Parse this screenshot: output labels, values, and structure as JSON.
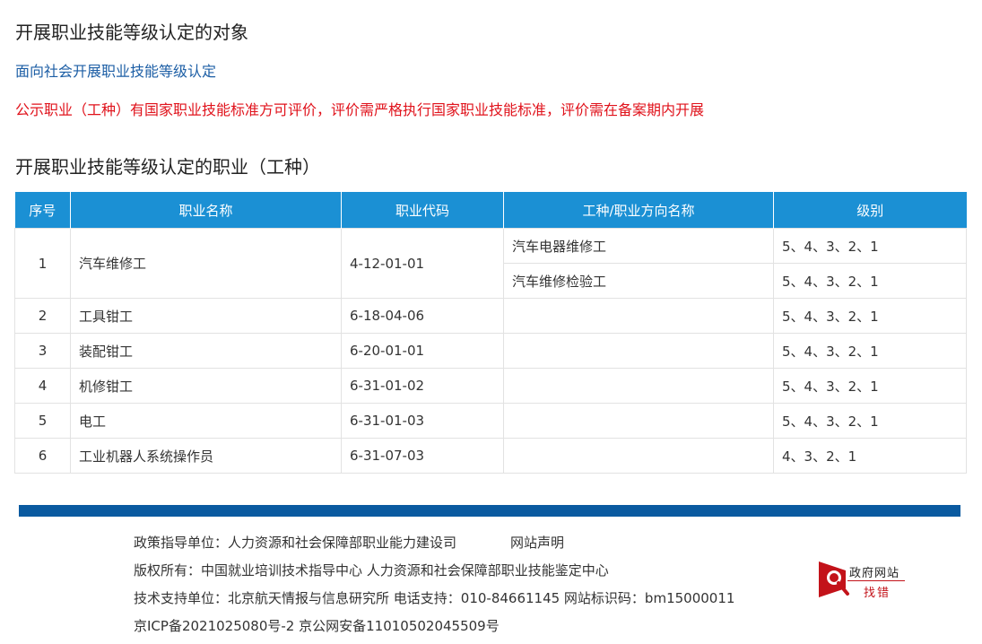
{
  "section1": {
    "title": "开展职业技能等级认定的对象",
    "subtitle": "面向社会开展职业技能等级认定",
    "notice": "公示职业（工种）有国家职业技能标准方可评价，评价需严格执行国家职业技能标准，评价需在备案期内开展"
  },
  "section2": {
    "title": "开展职业技能等级认定的职业（工种）",
    "headers": [
      "序号",
      "职业名称",
      "职业代码",
      "工种/职业方向名称",
      "级别"
    ],
    "rows": [
      {
        "no": "1",
        "name": "汽车维修工",
        "code": "4-12-01-01",
        "directions": [
          {
            "direction": "汽车电器维修工",
            "level": "5、4、3、2、1"
          },
          {
            "direction": "汽车维修检验工",
            "level": "5、4、3、2、1"
          }
        ]
      },
      {
        "no": "2",
        "name": "工具钳工",
        "code": "6-18-04-06",
        "directions": [
          {
            "direction": "",
            "level": "5、4、3、2、1"
          }
        ]
      },
      {
        "no": "3",
        "name": "装配钳工",
        "code": "6-20-01-01",
        "directions": [
          {
            "direction": "",
            "level": "5、4、3、2、1"
          }
        ]
      },
      {
        "no": "4",
        "name": "机修钳工",
        "code": "6-31-01-02",
        "directions": [
          {
            "direction": "",
            "level": "5、4、3、2、1"
          }
        ]
      },
      {
        "no": "5",
        "name": "电工",
        "code": "6-31-01-03",
        "directions": [
          {
            "direction": "",
            "level": "5、4、3、2、1"
          }
        ]
      },
      {
        "no": "6",
        "name": "工业机器人系统操作员",
        "code": "6-31-07-03",
        "directions": [
          {
            "direction": "",
            "level": "4、3、2、1"
          }
        ]
      }
    ]
  },
  "footer": {
    "guidance": "政策指导单位：人力资源和社会保障部职业能力建设司",
    "declaration": "网站声明",
    "copyright": "版权所有：中国就业培训技术指导中心  人力资源和社会保障部职业技能鉴定中心",
    "support": "技术支持单位：北京航天情报与信息研究所   电话支持：010-84661145   网站标识码：bm15000011",
    "icp": "京ICP备2021025080号-2     京公网安备11010502045509号"
  },
  "badge": {
    "icon": "magnifier-icon",
    "line1": "政府网站",
    "line2": "找错",
    "color": "#c3131a"
  },
  "colors": {
    "header_bg": "#1b90d4",
    "subtitle": "#1c5ea5",
    "notice": "#e0121b",
    "bar": "#0a5aa0"
  }
}
